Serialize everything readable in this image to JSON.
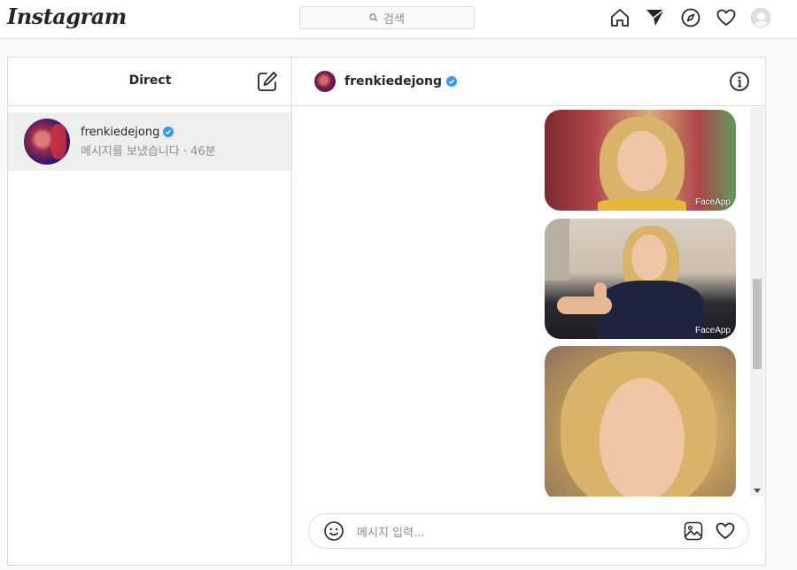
{
  "app": {
    "logo": "Instagram"
  },
  "topnav": {
    "search_placeholder": "검색",
    "icons": [
      "home-icon",
      "direct-icon",
      "explore-icon",
      "heart-icon",
      "profile-avatar"
    ]
  },
  "inbox": {
    "title": "Direct",
    "conversations": [
      {
        "username": "frenkiedejong",
        "verified": true,
        "preview": "메시지를 보냈습니다 · 46분"
      }
    ]
  },
  "thread": {
    "username": "frenkiedejong",
    "verified": true,
    "messages": [
      {
        "type": "image",
        "watermark": "FaceApp"
      },
      {
        "type": "image",
        "watermark": "FaceApp"
      },
      {
        "type": "image",
        "watermark": ""
      }
    ],
    "composer_placeholder": "메시지 입력..."
  },
  "colors": {
    "verified_blue": "#3897f0",
    "border": "#dbdbdb",
    "selected_row": "#efefef"
  }
}
